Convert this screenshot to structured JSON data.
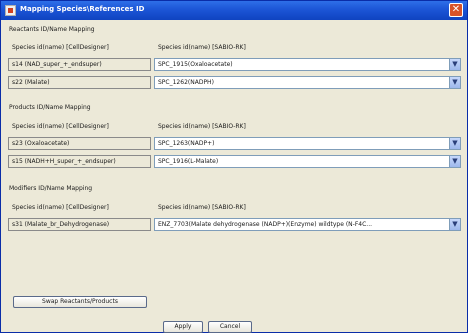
{
  "window": {
    "title": "Mapping Species\\References ID",
    "close_glyph": "✕"
  },
  "reactants": {
    "section_label": "Reactants ID/Name Mapping",
    "left_header": "Species id(name) [CellDesigner]",
    "right_header": "Species id(name) [SABIO-RK]",
    "rows": [
      {
        "left": "s14 (NAD_super_+_endsuper)",
        "right": "SPC_1915(Oxaloacetate)"
      },
      {
        "left": "s22 (Malate)",
        "right": "SPC_1262(NADPH)"
      }
    ]
  },
  "products": {
    "section_label": "Products ID/Name Mapping",
    "left_header": "Species id(name) [CellDesigner]",
    "right_header": "Species id(name) [SABIO-RK]",
    "rows": [
      {
        "left": "s23 (Oxaloacetate)",
        "right": "SPC_1263(NADP+)"
      },
      {
        "left": "s15 (NADH+H_super_+_endsuper)",
        "right": "SPC_1916(L-Malate)"
      }
    ]
  },
  "modifiers": {
    "section_label": "Modifiers ID/Name Mapping",
    "left_header": "Species id(name) [CellDesigner]",
    "right_header": "Species id(name) [SABIO-RK]",
    "rows": [
      {
        "left": "s31 (Malate_br_Dehydrogenase)",
        "right": "ENZ_7703(Malate dehydrogenase (NADP+)(Enzyme) wildtype (N-F4C..."
      }
    ]
  },
  "buttons": {
    "swap": "Swap Reactants/Products",
    "apply": "Apply",
    "cancel": "Cancel"
  },
  "colors": {
    "titlebar": "#1c55d6",
    "dialog_bg": "#ece9d8",
    "close": "#d8532a"
  }
}
